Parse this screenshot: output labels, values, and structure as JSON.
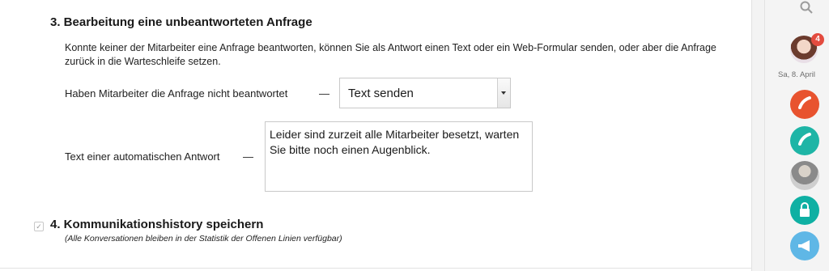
{
  "section3": {
    "title": "3. Bearbeitung eine unbeantworteten Anfrage",
    "description": "Konnte keiner der Mitarbeiter eine Anfrage beantworten, können Sie als Antwort einen Text oder ein Web-Formular senden, oder aber die Anfrage zurück in die Warteschleife setzen.",
    "row1": {
      "label": "Haben Mitarbeiter die Anfrage nicht beantwortet",
      "dash": "—",
      "select_value": "Text senden"
    },
    "row2": {
      "label": "Text einer automatischen Antwort",
      "dash": "—",
      "textarea_value": "Leider sind zurzeit alle Mitarbeiter besetzt, warten Sie bitte noch einen Augenblick."
    }
  },
  "section4": {
    "checkbox_mark": "✓",
    "title": "4. Kommunikationshistory speichern",
    "note": "(Alle Konversationen bleiben in der Statistik der Offenen Linien verfügbar)"
  },
  "rail": {
    "badge_count": "4",
    "date": "Sa, 8. April",
    "icons": [
      "search-icon",
      "phone-icon",
      "phone-icon",
      "avatar",
      "lock-icon",
      "megaphone-icon"
    ],
    "colors": {
      "red": "#e8532f",
      "teal": "#1eb5a6",
      "teal2": "#0fb0a3",
      "blue": "#5fb7e6",
      "badge": "#e34b3f"
    }
  }
}
